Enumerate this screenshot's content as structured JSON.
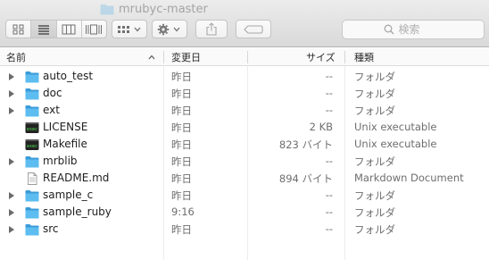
{
  "window": {
    "title": "mrubyc-master"
  },
  "toolbar": {
    "view_icon": "icon-view",
    "list_view": "list-view",
    "column_view": "column-view",
    "cover_flow": "cover-flow",
    "group_button": "group-by",
    "action_button": "action-gear",
    "share_button": "share",
    "tag_button": "tag"
  },
  "search": {
    "placeholder": "検索"
  },
  "columns": {
    "name": "名前",
    "date": "変更日",
    "size": "サイズ",
    "kind": "種類"
  },
  "files": [
    {
      "name": "auto_test",
      "date": "昨日",
      "size": "--",
      "kind": "フォルダ",
      "type": "folder"
    },
    {
      "name": "doc",
      "date": "昨日",
      "size": "--",
      "kind": "フォルダ",
      "type": "folder"
    },
    {
      "name": "ext",
      "date": "昨日",
      "size": "--",
      "kind": "フォルダ",
      "type": "folder"
    },
    {
      "name": "LICENSE",
      "date": "昨日",
      "size": "2 KB",
      "kind": "Unix executable",
      "type": "exec"
    },
    {
      "name": "Makefile",
      "date": "昨日",
      "size": "823 バイト",
      "kind": "Unix executable",
      "type": "exec"
    },
    {
      "name": "mrblib",
      "date": "昨日",
      "size": "--",
      "kind": "フォルダ",
      "type": "folder"
    },
    {
      "name": "README.md",
      "date": "昨日",
      "size": "894 バイト",
      "kind": "Markdown Document",
      "type": "doc"
    },
    {
      "name": "sample_c",
      "date": "昨日",
      "size": "--",
      "kind": "フォルダ",
      "type": "folder"
    },
    {
      "name": "sample_ruby",
      "date": "9:16",
      "size": "--",
      "kind": "フォルダ",
      "type": "folder"
    },
    {
      "name": "src",
      "date": "昨日",
      "size": "--",
      "kind": "フォルダ",
      "type": "folder"
    }
  ],
  "colors": {
    "folder": "#4fb3ea",
    "folder_dark": "#3a9bd8",
    "toolbar_bg": "#dcdcdc"
  }
}
